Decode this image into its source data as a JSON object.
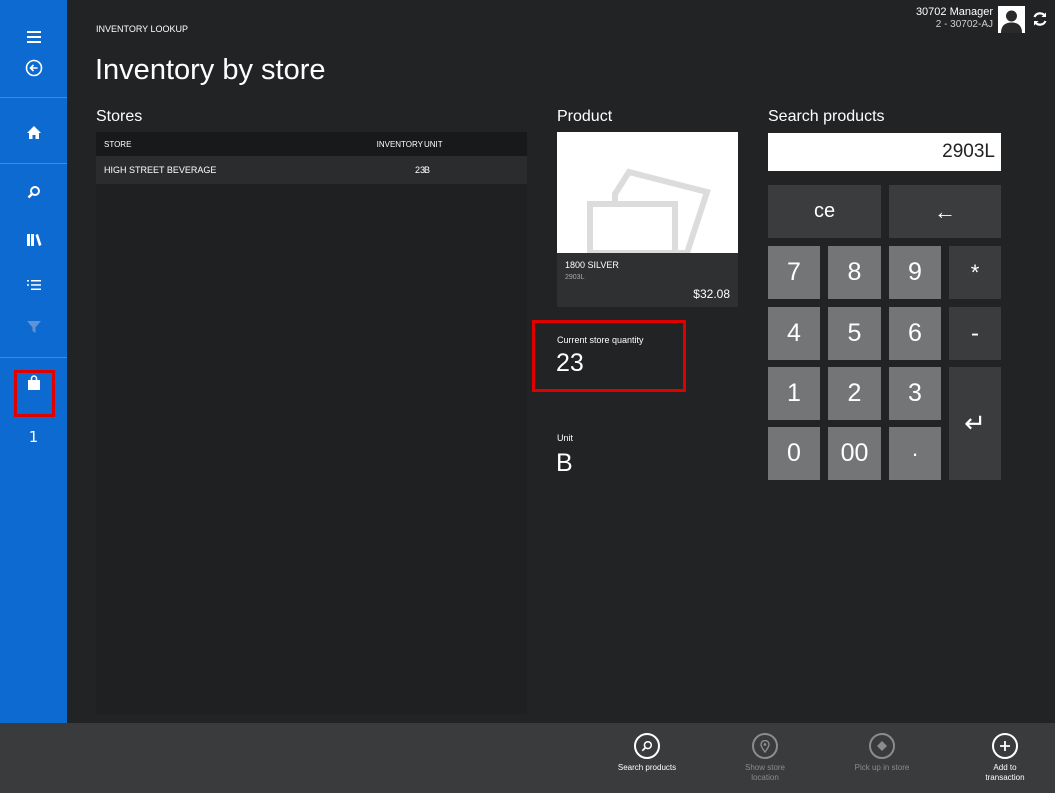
{
  "header": {
    "breadcrumb": "INVENTORY LOOKUP",
    "title": "Inventory by store",
    "user_name": "30702 Manager",
    "user_sub": "2 - 30702-AJ"
  },
  "sidebar": {
    "cart_count": "1",
    "items": [
      {
        "name": "menu"
      },
      {
        "name": "back"
      },
      {
        "name": "home"
      },
      {
        "name": "search"
      },
      {
        "name": "products"
      },
      {
        "name": "list"
      },
      {
        "name": "filter",
        "disabled": true
      },
      {
        "name": "cart",
        "highlighted": true
      }
    ]
  },
  "stores": {
    "title": "Stores",
    "columns": [
      "STORE",
      "INVENTORY",
      "UNIT"
    ],
    "rows": [
      {
        "store": "HIGH STREET BEVERAGE",
        "inventory": "23",
        "unit": "B"
      }
    ]
  },
  "product": {
    "title": "Product",
    "name": "1800 SILVER",
    "sku": "2903L",
    "price": "$32.08",
    "current_qty_label": "Current store quantity",
    "current_qty": "23",
    "unit_label": "Unit",
    "unit": "B"
  },
  "search": {
    "title": "Search products",
    "value": "2903L",
    "keys": {
      "clear": "ce",
      "backspace": "←",
      "k7": "7",
      "k8": "8",
      "k9": "9",
      "star": "*",
      "k4": "4",
      "k5": "5",
      "k6": "6",
      "minus": "-",
      "k1": "1",
      "k2": "2",
      "k3": "3",
      "enter": "↵",
      "k0": "0",
      "k00": "00",
      "dot": "·"
    }
  },
  "appbar": {
    "search_products": "Search products",
    "show_store_location": "Show store location",
    "pick_up_in_store": "Pick up in store",
    "add_to_transaction": "Add to transaction"
  },
  "colors": {
    "sidebar": "#0d6ad0",
    "background": "#222324",
    "highlight": "#e00000",
    "key_dark": "#3a3c3e",
    "key_light": "#737577"
  }
}
